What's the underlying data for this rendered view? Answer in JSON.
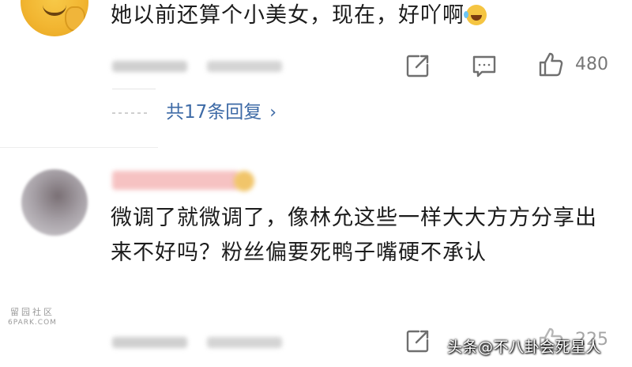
{
  "comments": [
    {
      "text": "她以前还算个小美女，现在，好吖啊",
      "emoji": "laugh-cry-emoji",
      "likes": "480",
      "replies_label": "共17条回复",
      "replies_chevron": "›"
    },
    {
      "text": "微调了就微调了，像林允这些一样大大方方分享出来不好吗？粉丝偏要死鸭子嘴硬不承认",
      "likes": "225"
    }
  ],
  "icons": {
    "share": "share-icon",
    "comment": "comment-icon",
    "like": "thumbs-up-icon"
  },
  "watermarks": {
    "site_line1": "留园社区",
    "site_line2": "6PARK.COM",
    "toutiao": "头条@不八卦会死星人"
  },
  "colors": {
    "link": "#3d6aa6",
    "text": "#1c1c1c",
    "icon": "#6f6f6f"
  }
}
